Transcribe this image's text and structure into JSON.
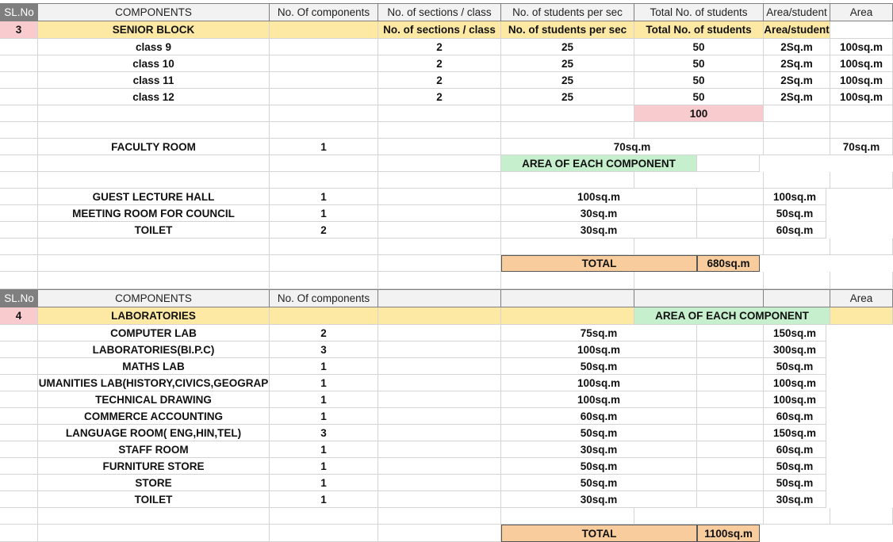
{
  "headers": {
    "sl": "SL.No",
    "components": "COMPONENTS",
    "num_components": "No. Of components",
    "sections": "No. of sections / class",
    "students_per_sec": "No. of students per sec",
    "total_students": "Total No. of students",
    "area_student": "Area/student",
    "area": "Area"
  },
  "senior": {
    "sl": "3",
    "title": "SENIOR BLOCK",
    "sub_sections": "No. of sections / class",
    "sub_students": "No. of students per sec",
    "sub_total": "Total No. of students",
    "sub_area_student": "Area/student",
    "classes": [
      {
        "name": "class 9",
        "sections": "2",
        "per_sec": "25",
        "total": "50",
        "area_student": "2Sq.m",
        "area": "100sq.m"
      },
      {
        "name": "class 10",
        "sections": "2",
        "per_sec": "25",
        "total": "50",
        "area_student": "2Sq.m",
        "area": "100sq.m"
      },
      {
        "name": "class 11",
        "sections": "2",
        "per_sec": "25",
        "total": "50",
        "area_student": "2Sq.m",
        "area": "100sq.m"
      },
      {
        "name": "class 12",
        "sections": "2",
        "per_sec": "25",
        "total": "50",
        "area_student": "2Sq.m",
        "area": "100sq.m"
      }
    ],
    "subtotal": "100",
    "faculty": {
      "name": "FACULTY ROOM",
      "count": "1",
      "each": "70sq.m",
      "area": "70sq.m"
    },
    "area_each_label": "AREA OF EACH COMPONENT",
    "rooms": [
      {
        "name": "GUEST LECTURE HALL",
        "count": "1",
        "each": "100sq.m",
        "area": "100sq.m"
      },
      {
        "name": "MEETING ROOM FOR COUNCIL",
        "count": "1",
        "each": "30sq.m",
        "area": "50sq.m"
      },
      {
        "name": "TOILET",
        "count": "2",
        "each": "30sq.m",
        "area": "60sq.m"
      }
    ],
    "total_label": "TOTAL",
    "total_value": "680sq.m"
  },
  "labs_header": {
    "sl": "SL.No",
    "components": "COMPONENTS",
    "num_components": "No. Of components",
    "area": "Area"
  },
  "labs": {
    "sl": "4",
    "title": "LABORATORIES",
    "area_each_label": "AREA OF EACH COMPONENT",
    "items": [
      {
        "name": "COMPUTER LAB",
        "count": "2",
        "each": "75sq.m",
        "area": "150sq.m"
      },
      {
        "name": "LABORATORIES(BI.P.C)",
        "count": "3",
        "each": "100sq.m",
        "area": "300sq.m"
      },
      {
        "name": "MATHS LAB",
        "count": "1",
        "each": "50sq.m",
        "area": "50sq.m"
      },
      {
        "name": "HUMANITIES LAB(HISTORY,CIVICS,GEOGRAPH",
        "count": "1",
        "each": "100sq.m",
        "area": "100sq.m"
      },
      {
        "name": "TECHNICAL DRAWING",
        "count": "1",
        "each": "100sq.m",
        "area": "100sq.m"
      },
      {
        "name": "COMMERCE ACCOUNTING",
        "count": "1",
        "each": "60sq.m",
        "area": "60sq.m"
      },
      {
        "name": "LANGUAGE ROOM( ENG,HIN,TEL)",
        "count": "3",
        "each": "50sq.m",
        "area": "150sq.m"
      },
      {
        "name": "STAFF ROOM",
        "count": "1",
        "each": "30sq.m",
        "area": "60sq.m"
      },
      {
        "name": "FURNITURE STORE",
        "count": "1",
        "each": "50sq.m",
        "area": "50sq.m"
      },
      {
        "name": "STORE",
        "count": "1",
        "each": "50sq.m",
        "area": "50sq.m"
      },
      {
        "name": "TOILET",
        "count": "1",
        "each": "30sq.m",
        "area": "30sq.m"
      }
    ],
    "total_label": "TOTAL",
    "total_value": "1100sq.m"
  }
}
